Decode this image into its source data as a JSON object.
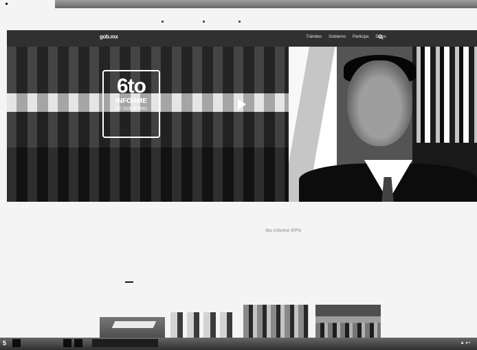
{
  "site": {
    "logo": "gob.mx",
    "nav": [
      "Trámites",
      "Gobierno",
      "Participa",
      "Datos"
    ]
  },
  "hero": {
    "badge_number": "6to",
    "badge_line1": "INFORME",
    "badge_line2": "DE GOBIERNO",
    "caption": "6to Informe EPN"
  },
  "taskbar": {
    "start_label": "5"
  },
  "icons": [
    "play-icon",
    "search-icon"
  ]
}
